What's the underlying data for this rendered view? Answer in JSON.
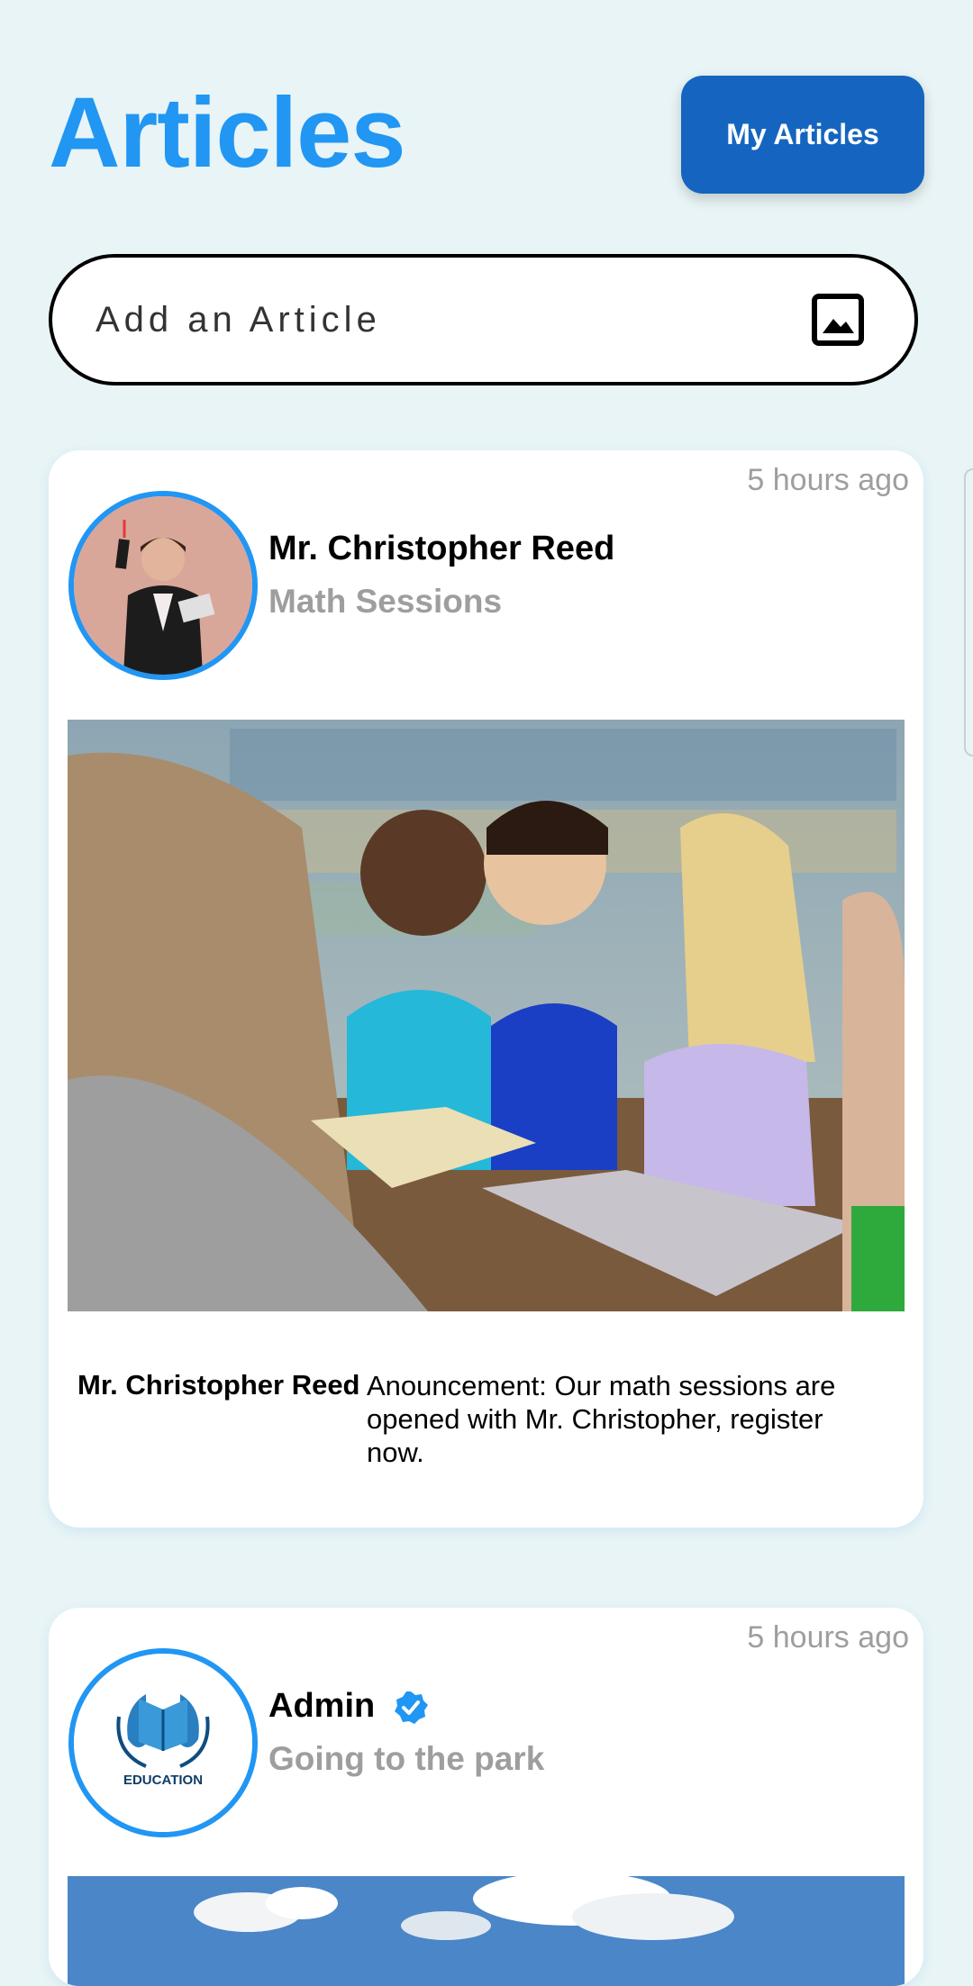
{
  "header": {
    "title": "Articles",
    "my_articles_label": "My Articles"
  },
  "composer": {
    "placeholder": "Add an Article",
    "icon": "image-icon"
  },
  "posts": [
    {
      "time": "5 hours ago",
      "author": "Mr. Christopher Reed",
      "subtitle": "Math Sessions",
      "image": "children-reading-photo",
      "caption_author": "Mr. Christopher Reed",
      "caption": "Anouncement: Our math sessions are opened with Mr. Christopher, register now."
    },
    {
      "time": "5 hours ago",
      "author": "Admin",
      "verified": true,
      "subtitle": "Going to the park",
      "avatar_logo_text": "EDUCATION",
      "image": "sky-photo"
    }
  ],
  "colors": {
    "accent": "#2196f3",
    "button": "#1565c0",
    "background": "#e8f4f5"
  }
}
